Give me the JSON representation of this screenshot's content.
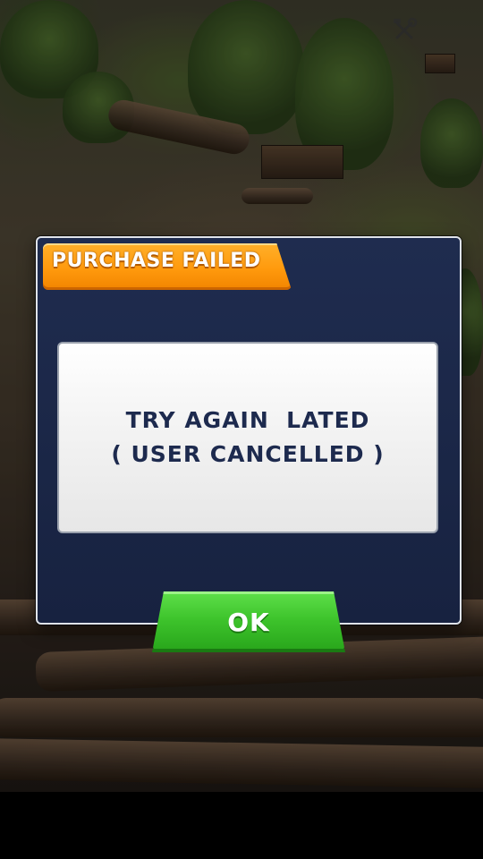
{
  "dialog": {
    "title": "PURCHASE FAILED",
    "message_line1": "TRY AGAIN  LATED",
    "message_line2": "( USER CANCELLED )",
    "ok_label": "OK"
  },
  "hud": {
    "tools_icon": "tools-icon"
  },
  "colors": {
    "title_banner": "#ff9a0d",
    "dialog_bg": "#1f2c4f",
    "message_text": "#1d2a4e",
    "ok_button": "#3ec42c"
  }
}
